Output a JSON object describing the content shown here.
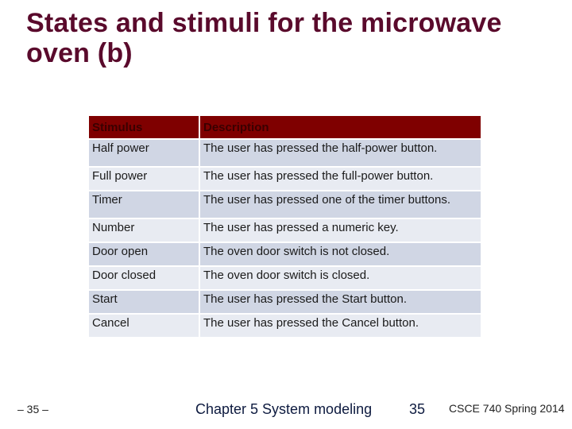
{
  "slide": {
    "title": "States and stimuli for the microwave oven (b)"
  },
  "table": {
    "headers": [
      "Stimulus",
      "Description"
    ],
    "rows": [
      {
        "stimulus": "Half power",
        "description": "The user has pressed the half-power button."
      },
      {
        "stimulus": "Full power",
        "description": "The user has pressed the full-power button."
      },
      {
        "stimulus": "Timer",
        "description": "The user has pressed one of the timer buttons."
      },
      {
        "stimulus": "Number",
        "description": "The user has pressed a numeric key."
      },
      {
        "stimulus": "Door open",
        "description": "The oven door switch is not closed."
      },
      {
        "stimulus": "Door closed",
        "description": "The oven door switch is closed."
      },
      {
        "stimulus": "Start",
        "description": "The user has pressed the Start button."
      },
      {
        "stimulus": "Cancel",
        "description": "The user has pressed the Cancel button."
      }
    ]
  },
  "footer": {
    "left": "– 35 –",
    "center": "Chapter 5 System modeling",
    "page_number": "35",
    "right": "CSCE 740 Spring  2014"
  },
  "colors": {
    "title": "#5a0a2c",
    "header_bg": "#7f0000",
    "row_odd": "#d0d6e4",
    "row_even": "#e8ebf2"
  }
}
